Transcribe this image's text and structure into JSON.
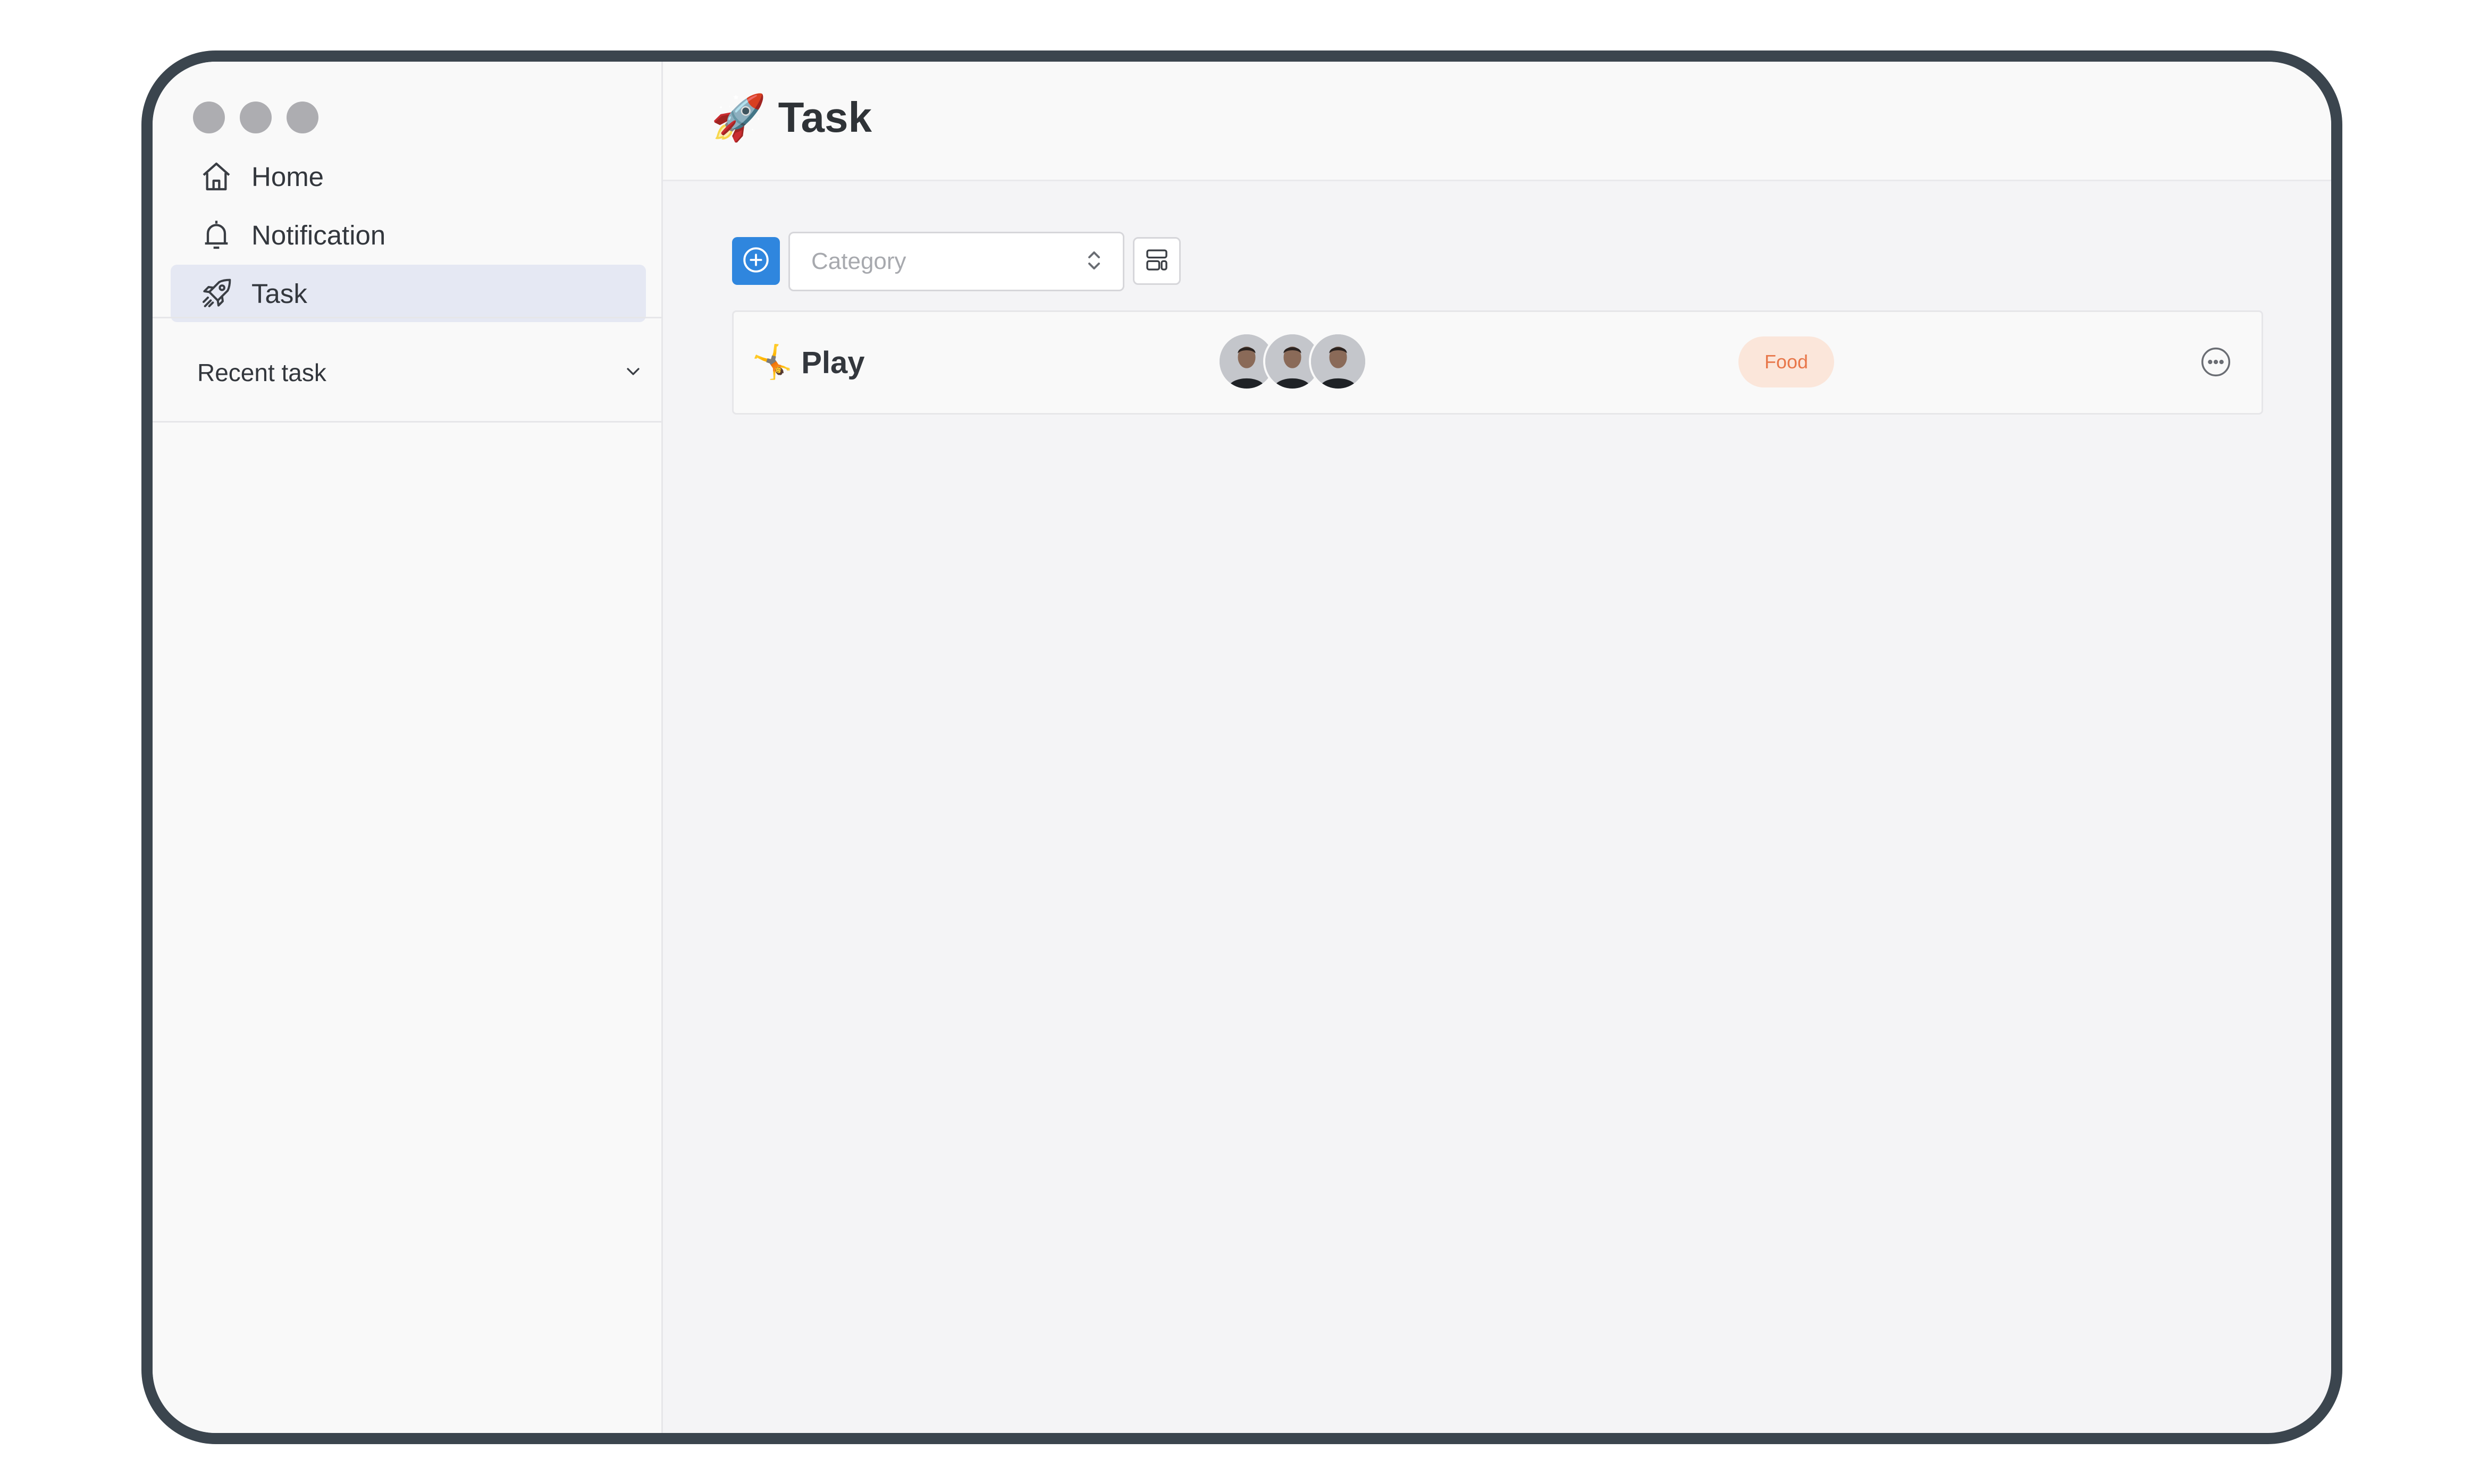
{
  "sidebar": {
    "items": [
      {
        "label": "Home",
        "icon": "home-icon"
      },
      {
        "label": "Notification",
        "icon": "bell-icon"
      },
      {
        "label": "Task",
        "icon": "rocket-icon",
        "active": true
      }
    ],
    "recent_label": "Recent task"
  },
  "header": {
    "title": "Task",
    "emoji": "🚀"
  },
  "toolbar": {
    "category_placeholder": "Category"
  },
  "tasks": [
    {
      "emoji": "🤸",
      "name": "Play",
      "tag": "Food",
      "assignee_count": 3
    }
  ],
  "colors": {
    "accent": "#2f86de",
    "active_nav_bg": "#e5e8f3",
    "tag_bg": "#fbe6da",
    "tag_text": "#e8774a",
    "frame": "#3b454e"
  }
}
